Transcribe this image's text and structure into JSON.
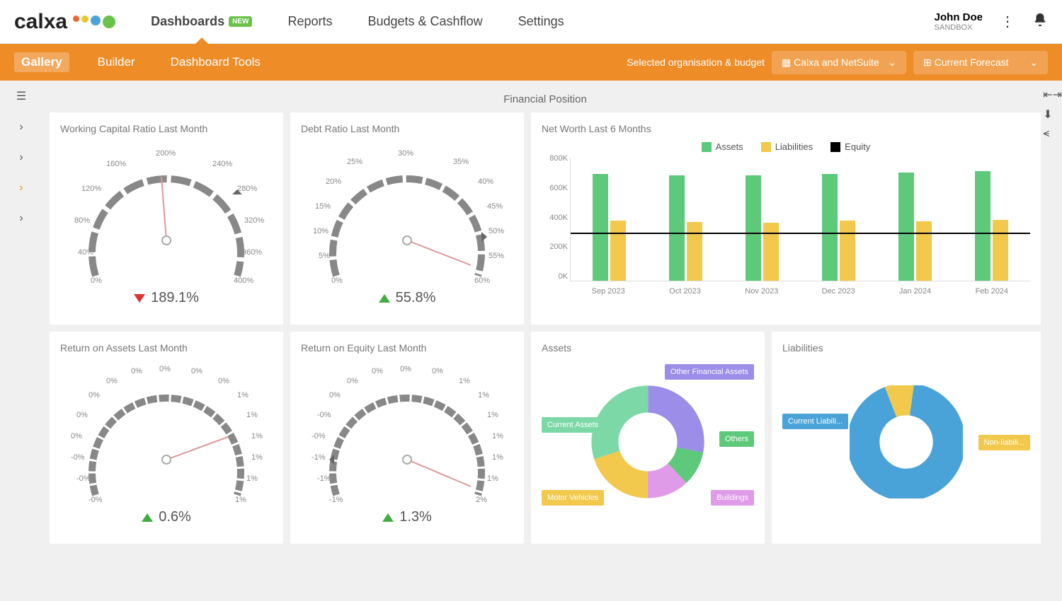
{
  "brand": "calxa",
  "nav": {
    "dashboards": "Dashboards",
    "new": "NEW",
    "reports": "Reports",
    "budgets": "Budgets & Cashflow",
    "settings": "Settings"
  },
  "user": {
    "name": "John Doe",
    "role": "SANDBOX"
  },
  "subnav": {
    "gallery": "Gallery",
    "builder": "Builder",
    "tools": "Dashboard Tools"
  },
  "orgLabel": "Selected organisation & budget",
  "orgSelect": "Calxa and NetSuite",
  "budgetSelect": "Current Forecast",
  "pageTitle": "Financial Position",
  "cards": {
    "wcr": {
      "title": "Working Capital Ratio Last Month",
      "value": "189.1%"
    },
    "debt": {
      "title": "Debt Ratio Last Month",
      "value": "55.8%"
    },
    "networth": {
      "title": "Net Worth Last 6 Months"
    },
    "roa": {
      "title": "Return on Assets Last Month",
      "value": "0.6%"
    },
    "roe": {
      "title": "Return on Equity Last Month",
      "value": "1.3%"
    },
    "assets": {
      "title": "Assets"
    },
    "liab": {
      "title": "Liabilities"
    }
  },
  "legend": {
    "assets": "Assets",
    "liabilities": "Liabilities",
    "equity": "Equity"
  },
  "chart_data": [
    {
      "type": "gauge",
      "title": "Working Capital Ratio Last Month",
      "value": 189.1,
      "min": 0,
      "max": 400,
      "ticks": [
        "0%",
        "40%",
        "80%",
        "120%",
        "160%",
        "200%",
        "240%",
        "280%",
        "320%",
        "360%",
        "400%"
      ],
      "trend": "down"
    },
    {
      "type": "gauge",
      "title": "Debt Ratio Last Month",
      "value": 55.8,
      "min": 0,
      "max": 60,
      "ticks": [
        "0%",
        "5%",
        "10%",
        "15%",
        "20%",
        "25%",
        "30%",
        "35%",
        "40%",
        "45%",
        "50%",
        "55%",
        "60%"
      ],
      "trend": "up"
    },
    {
      "type": "bar",
      "title": "Net Worth Last 6 Months",
      "categories": [
        "Sep 2023",
        "Oct 2023",
        "Nov 2023",
        "Dec 2023",
        "Jan 2024",
        "Feb 2024"
      ],
      "series": [
        {
          "name": "Assets",
          "values": [
            690000,
            680000,
            680000,
            690000,
            700000,
            710000
          ],
          "color": "#5ec97a"
        },
        {
          "name": "Liabilities",
          "values": [
            390000,
            380000,
            375000,
            390000,
            385000,
            395000
          ],
          "color": "#f2c94c"
        },
        {
          "name": "Equity",
          "values": [
            300000,
            300000,
            305000,
            300000,
            315000,
            315000
          ],
          "color": "#000",
          "style": "line"
        }
      ],
      "ylabel": "",
      "ylim": [
        0,
        800000
      ],
      "yticks": [
        "0K",
        "200K",
        "400K",
        "600K",
        "800K"
      ]
    },
    {
      "type": "gauge",
      "title": "Return on Assets Last Month",
      "value": 0.6,
      "min": 0,
      "max": 1,
      "ticks": [
        "-0%",
        "-0%",
        "-0%",
        "-0%",
        "0%",
        "0%",
        "0%",
        "0%",
        "0%",
        "0%",
        "0%",
        "1%",
        "1%",
        "1%",
        "1%",
        "1%",
        "1%",
        "1%",
        "1%",
        "1%",
        "1%"
      ],
      "trend": "up"
    },
    {
      "type": "gauge",
      "title": "Return on Equity Last Month",
      "value": 1.3,
      "min": -1,
      "max": 2,
      "ticks": [
        "-1%",
        "-1%",
        "-1%",
        "-1%",
        "-1%",
        "-0%",
        "-0%",
        "0%",
        "0%",
        "0%",
        "0%",
        "1%",
        "1%",
        "1%",
        "1%",
        "1%",
        "1%",
        "1%",
        "1%",
        "1%",
        "2%"
      ],
      "trend": "up"
    },
    {
      "type": "pie",
      "title": "Assets",
      "slices": [
        {
          "name": "Other Financial Assets",
          "value": 28,
          "color": "#9b8de8"
        },
        {
          "name": "Others",
          "value": 10,
          "color": "#5ec97a"
        },
        {
          "name": "Buildings",
          "value": 12,
          "color": "#e09be8"
        },
        {
          "name": "Motor Vehicles",
          "value": 20,
          "color": "#f2c94c"
        },
        {
          "name": "Current Assets",
          "value": 30,
          "color": "#7dd8a8"
        }
      ]
    },
    {
      "type": "pie",
      "title": "Liabilities",
      "slices": [
        {
          "name": "Current Liabili...",
          "value": 92,
          "color": "#4aa3d8"
        },
        {
          "name": "Non-liabili...",
          "value": 8,
          "color": "#f2c94c"
        }
      ]
    }
  ],
  "assetLabels": {
    "ofa": "Other Financial Assets",
    "others": "Others",
    "buildings": "Buildings",
    "motor": "Motor Vehicles",
    "current": "Current Assets"
  },
  "liabLabels": {
    "current": "Current Liabili...",
    "non": "Non-liabili..."
  }
}
